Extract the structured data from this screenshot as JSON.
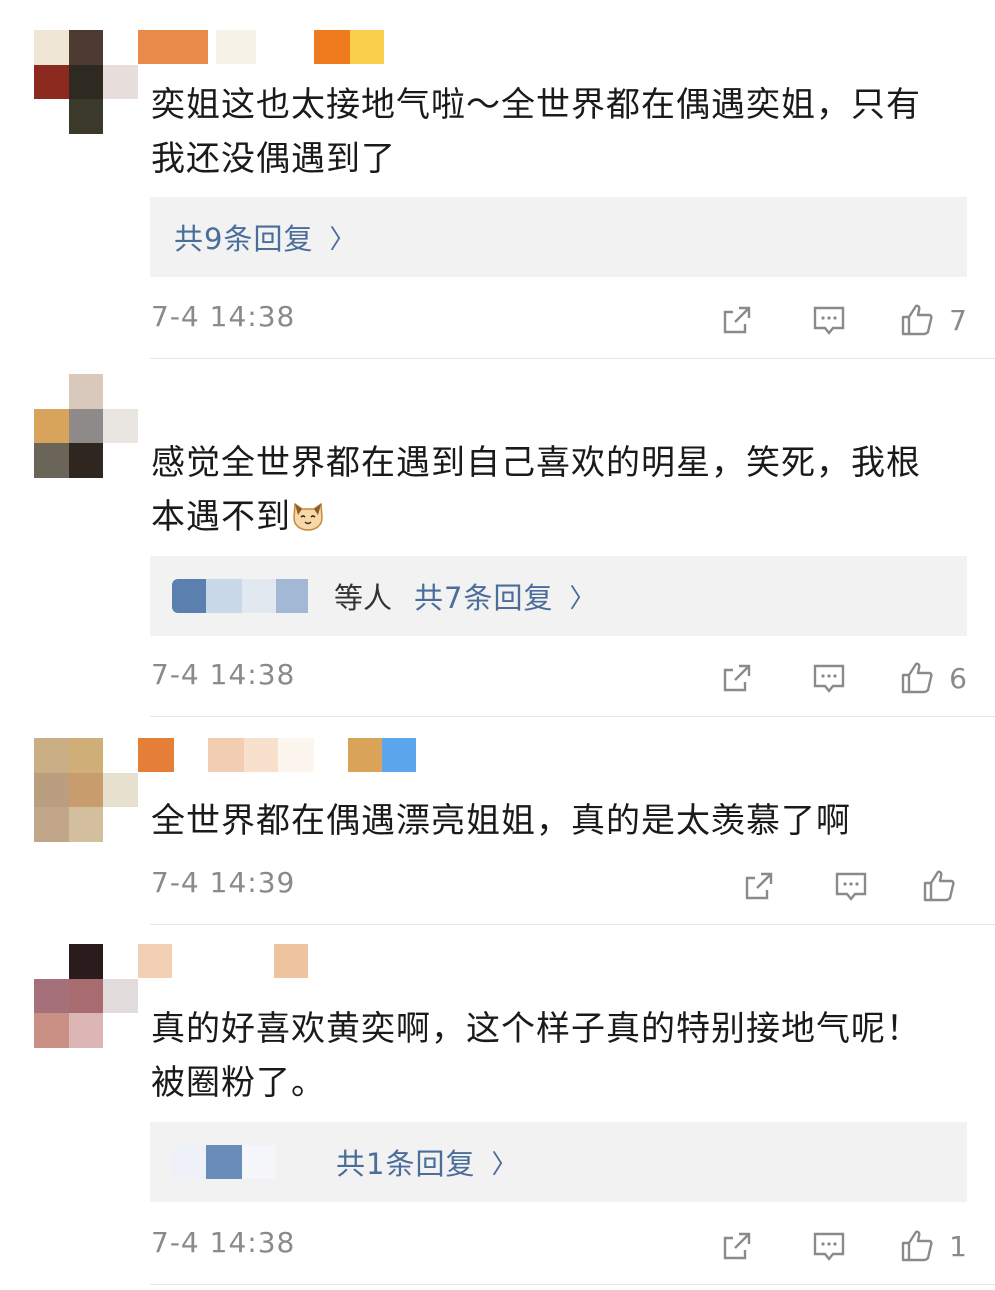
{
  "comments": [
    {
      "text": "奕姐这也太接地气啦～全世界都在偶遇奕姐，只有\n我还没偶遇到了",
      "reply_label": "共9条回复",
      "time": "7-4 14:38",
      "likes": "7"
    },
    {
      "text": "感觉全世界都在遇到自己喜欢的明星，笑死，我根\n本遇不到",
      "emoji": "cat-face-emoji",
      "reply_prefix": "等人",
      "reply_label": "共7条回复",
      "time": "7-4 14:38",
      "likes": "6"
    },
    {
      "text": "全世界都在偶遇漂亮姐姐，真的是太羡慕了啊",
      "time": "7-4 14:39",
      "likes": ""
    },
    {
      "text": "真的好喜欢黄奕啊，这个样子真的特别接地气呢！\n被圈粉了。",
      "reply_label": "共1条回复",
      "time": "7-4 14:38",
      "likes": "1"
    }
  ],
  "icons": {
    "share": "share-icon",
    "comment": "comment-icon",
    "like": "like-icon",
    "chevron": "chevron-right-icon"
  },
  "colors": {
    "link": "#4b6d9a",
    "meta": "#8a8a8a",
    "reply_bg": "#f2f2f2"
  },
  "chevron_glyph": "〉"
}
